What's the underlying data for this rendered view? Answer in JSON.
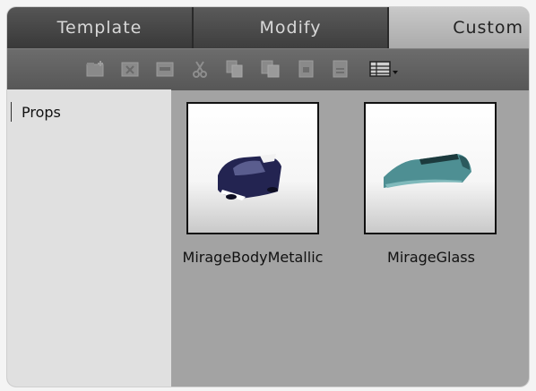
{
  "tabs": [
    {
      "label": "Template"
    },
    {
      "label": "Modify"
    },
    {
      "label": "Custom"
    }
  ],
  "toolbar": {
    "icons": [
      "new-folder-icon",
      "delete-icon",
      "rename-icon",
      "cut-icon",
      "copy-icon",
      "paste-icon",
      "duplicate-icon",
      "save-icon",
      "view-options-icon"
    ]
  },
  "list": {
    "items": [
      {
        "label": "Props"
      }
    ]
  },
  "items": [
    {
      "label": "MirageBodyMetallic",
      "icon": "car-body-thumbnail"
    },
    {
      "label": "MirageGlass",
      "icon": "car-glass-thumbnail"
    }
  ]
}
